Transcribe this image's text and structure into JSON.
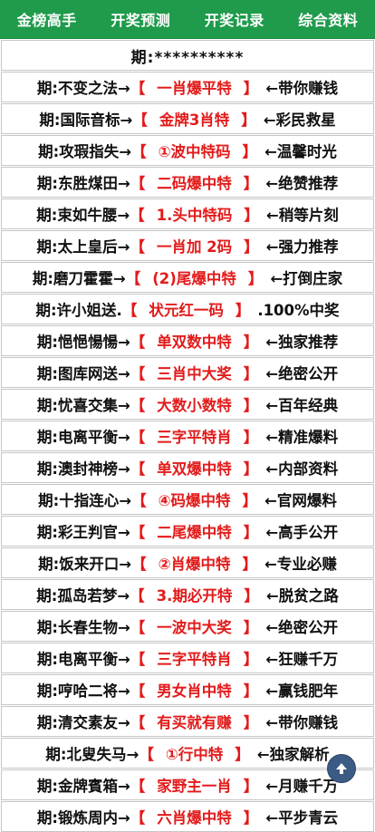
{
  "nav": {
    "items": [
      "金榜高手",
      "开奖预测",
      "开奖记录",
      "综合资料"
    ]
  },
  "header": "期:**********",
  "rows": [
    {
      "label": "期:不变之法→",
      "open": "【",
      "pred": "一肖爆平特",
      "close": "】",
      "suffix": "←带你赚钱"
    },
    {
      "label": "期:国际音标→",
      "open": "【",
      "pred": "金牌3肖特",
      "close": "】",
      "suffix": "←彩民救星"
    },
    {
      "label": "期:攻瑕指失→",
      "open": "【",
      "pred": "①波中特码",
      "close": "】",
      "suffix": "←温馨时光"
    },
    {
      "label": "期:东胜煤田→",
      "open": "【",
      "pred": "二码爆中特",
      "close": "】",
      "suffix": "←绝赞推荐"
    },
    {
      "label": "期:束如牛腰→",
      "open": "【",
      "pred": "1.头中特码",
      "close": "】",
      "suffix": "←稍等片刻"
    },
    {
      "label": "期:太上皇后→",
      "open": "【",
      "pred": "一肖加 2码",
      "close": "】",
      "suffix": "←强力推荐"
    },
    {
      "label": "期:磨刀霍霍→",
      "open": "【",
      "pred": "(2)尾爆中特",
      "close": "】",
      "suffix": "←打倒庄家"
    },
    {
      "label": "期:许小姐送.",
      "open": "【",
      "pred": "状元红一码",
      "close": "】",
      "suffix": ".100%中奖"
    },
    {
      "label": "期:悒悒愓愓→",
      "open": "【",
      "pred": "单双数中特",
      "close": "】",
      "suffix": "←独家推荐"
    },
    {
      "label": "期:图库网送→",
      "open": "【",
      "pred": "三肖中大奖",
      "close": "】",
      "suffix": "←绝密公开"
    },
    {
      "label": "期:忧喜交集→",
      "open": "【",
      "pred": "大数小数特",
      "close": "】",
      "suffix": "←百年经典"
    },
    {
      "label": "期:电离平衡→",
      "open": "【",
      "pred": "三字平特肖",
      "close": "】",
      "suffix": "←精准爆料"
    },
    {
      "label": "期:澳封神榜→",
      "open": "【",
      "pred": "单双爆中特",
      "close": "】",
      "suffix": "←内部资料"
    },
    {
      "label": "期:十指连心→",
      "open": "【",
      "pred": "④码爆中特",
      "close": "】",
      "suffix": "←官网爆料"
    },
    {
      "label": "期:彩王判官→",
      "open": "【",
      "pred": "二尾爆中特",
      "close": "】",
      "suffix": "←高手公开"
    },
    {
      "label": "期:饭来开口→",
      "open": "【",
      "pred": "②肖爆中特",
      "close": "】",
      "suffix": "←专业必赚"
    },
    {
      "label": "期:孤岛若梦→",
      "open": "【",
      "pred": "3.期必开特",
      "close": "】",
      "suffix": "←脱贫之路"
    },
    {
      "label": "期:长春生物→",
      "open": "【",
      "pred": "一波中大奖",
      "close": "】",
      "suffix": "←绝密公开"
    },
    {
      "label": "期:电离平衡→",
      "open": "【",
      "pred": "三字平特肖",
      "close": "】",
      "suffix": "←狂赚千万"
    },
    {
      "label": "期:哼哈二将→",
      "open": "【",
      "pred": "男女肖中特",
      "close": "】",
      "suffix": "←赢钱肥年"
    },
    {
      "label": "期:清交素友→",
      "open": "【",
      "pred": "有买就有赚",
      "close": "】",
      "suffix": "←带你赚钱"
    },
    {
      "label": "期:北叟失马→",
      "open": "【",
      "pred": "①行中特",
      "close": "】",
      "suffix": "←独家解析"
    },
    {
      "label": "期:金牌賓箱→",
      "open": "【",
      "pred": "家野主一肖",
      "close": "】",
      "suffix": "←月赚千万"
    },
    {
      "label": "期:锻炼周内→",
      "open": "【",
      "pred": "六肖爆中特",
      "close": "】",
      "suffix": "←平步青云"
    }
  ],
  "colors": {
    "nav_bg": "#1f9b4b",
    "accent_red": "#e21b1b",
    "scroll_btn": "#3b5a84"
  },
  "icons": {
    "scroll_top": "arrow-up-icon"
  }
}
